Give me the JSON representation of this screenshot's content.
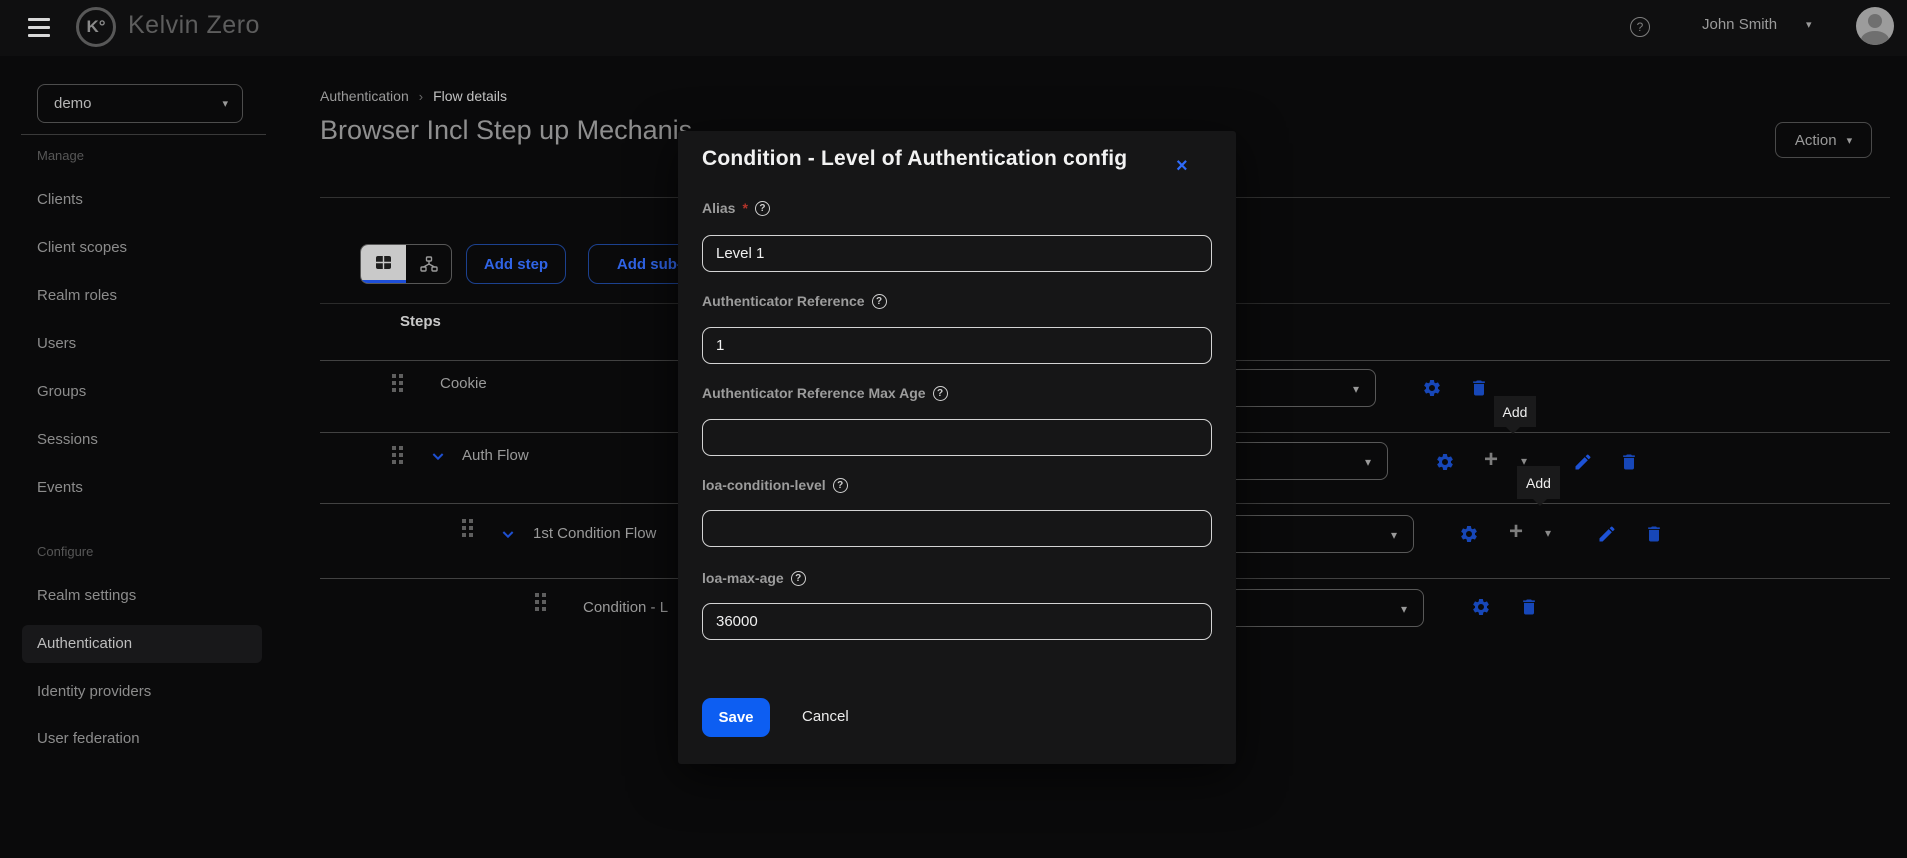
{
  "topbar": {
    "brand": "Kelvin Zero",
    "logo_text": "K°",
    "user": "John Smith"
  },
  "icons": {
    "chevron_down": "▾",
    "plus": "+",
    "close": "×",
    "question": "?",
    "breadcrumb_sep": "›"
  },
  "sidebar": {
    "realm_select": "demo",
    "manage_label": "Manage",
    "manage_items": [
      "Clients",
      "Client scopes",
      "Realm roles",
      "Users",
      "Groups",
      "Sessions",
      "Events"
    ],
    "configure_label": "Configure",
    "configure_items": [
      "Realm settings",
      "Authentication",
      "Identity providers",
      "User federation"
    ],
    "active_item": "Authentication"
  },
  "breadcrumb": {
    "level1": "Authentication",
    "level2": "Flow details"
  },
  "page": {
    "title": "Browser Incl Step up Mechanis",
    "action": "Action"
  },
  "toolbar": {
    "add_step": "Add step",
    "add_subflow": "Add sub-fl",
    "view_selected": "table"
  },
  "flow_table": {
    "header": "Steps",
    "rows": [
      {
        "name": "Cookie"
      },
      {
        "name": "Auth Flow"
      },
      {
        "name": "1st Condition Flow"
      },
      {
        "name": "Condition - L"
      }
    ],
    "tooltip1": "Add",
    "tooltip2": "Add"
  },
  "modal": {
    "title": "Condition - Level of Authentication config",
    "fields": [
      {
        "label": "Alias",
        "required": "*",
        "value": "Level 1"
      },
      {
        "label": "Authenticator Reference",
        "value": "1"
      },
      {
        "label": "Authenticator Reference Max Age",
        "value": ""
      },
      {
        "label": "loa-condition-level",
        "value": ""
      },
      {
        "label": "loa-max-age",
        "value": "36000"
      }
    ],
    "save": "Save",
    "cancel": "Cancel"
  },
  "colors": {
    "accent_blue": "#0d5ef2",
    "icon_blue": "#1747b8",
    "link_blue": "#3064e6"
  }
}
